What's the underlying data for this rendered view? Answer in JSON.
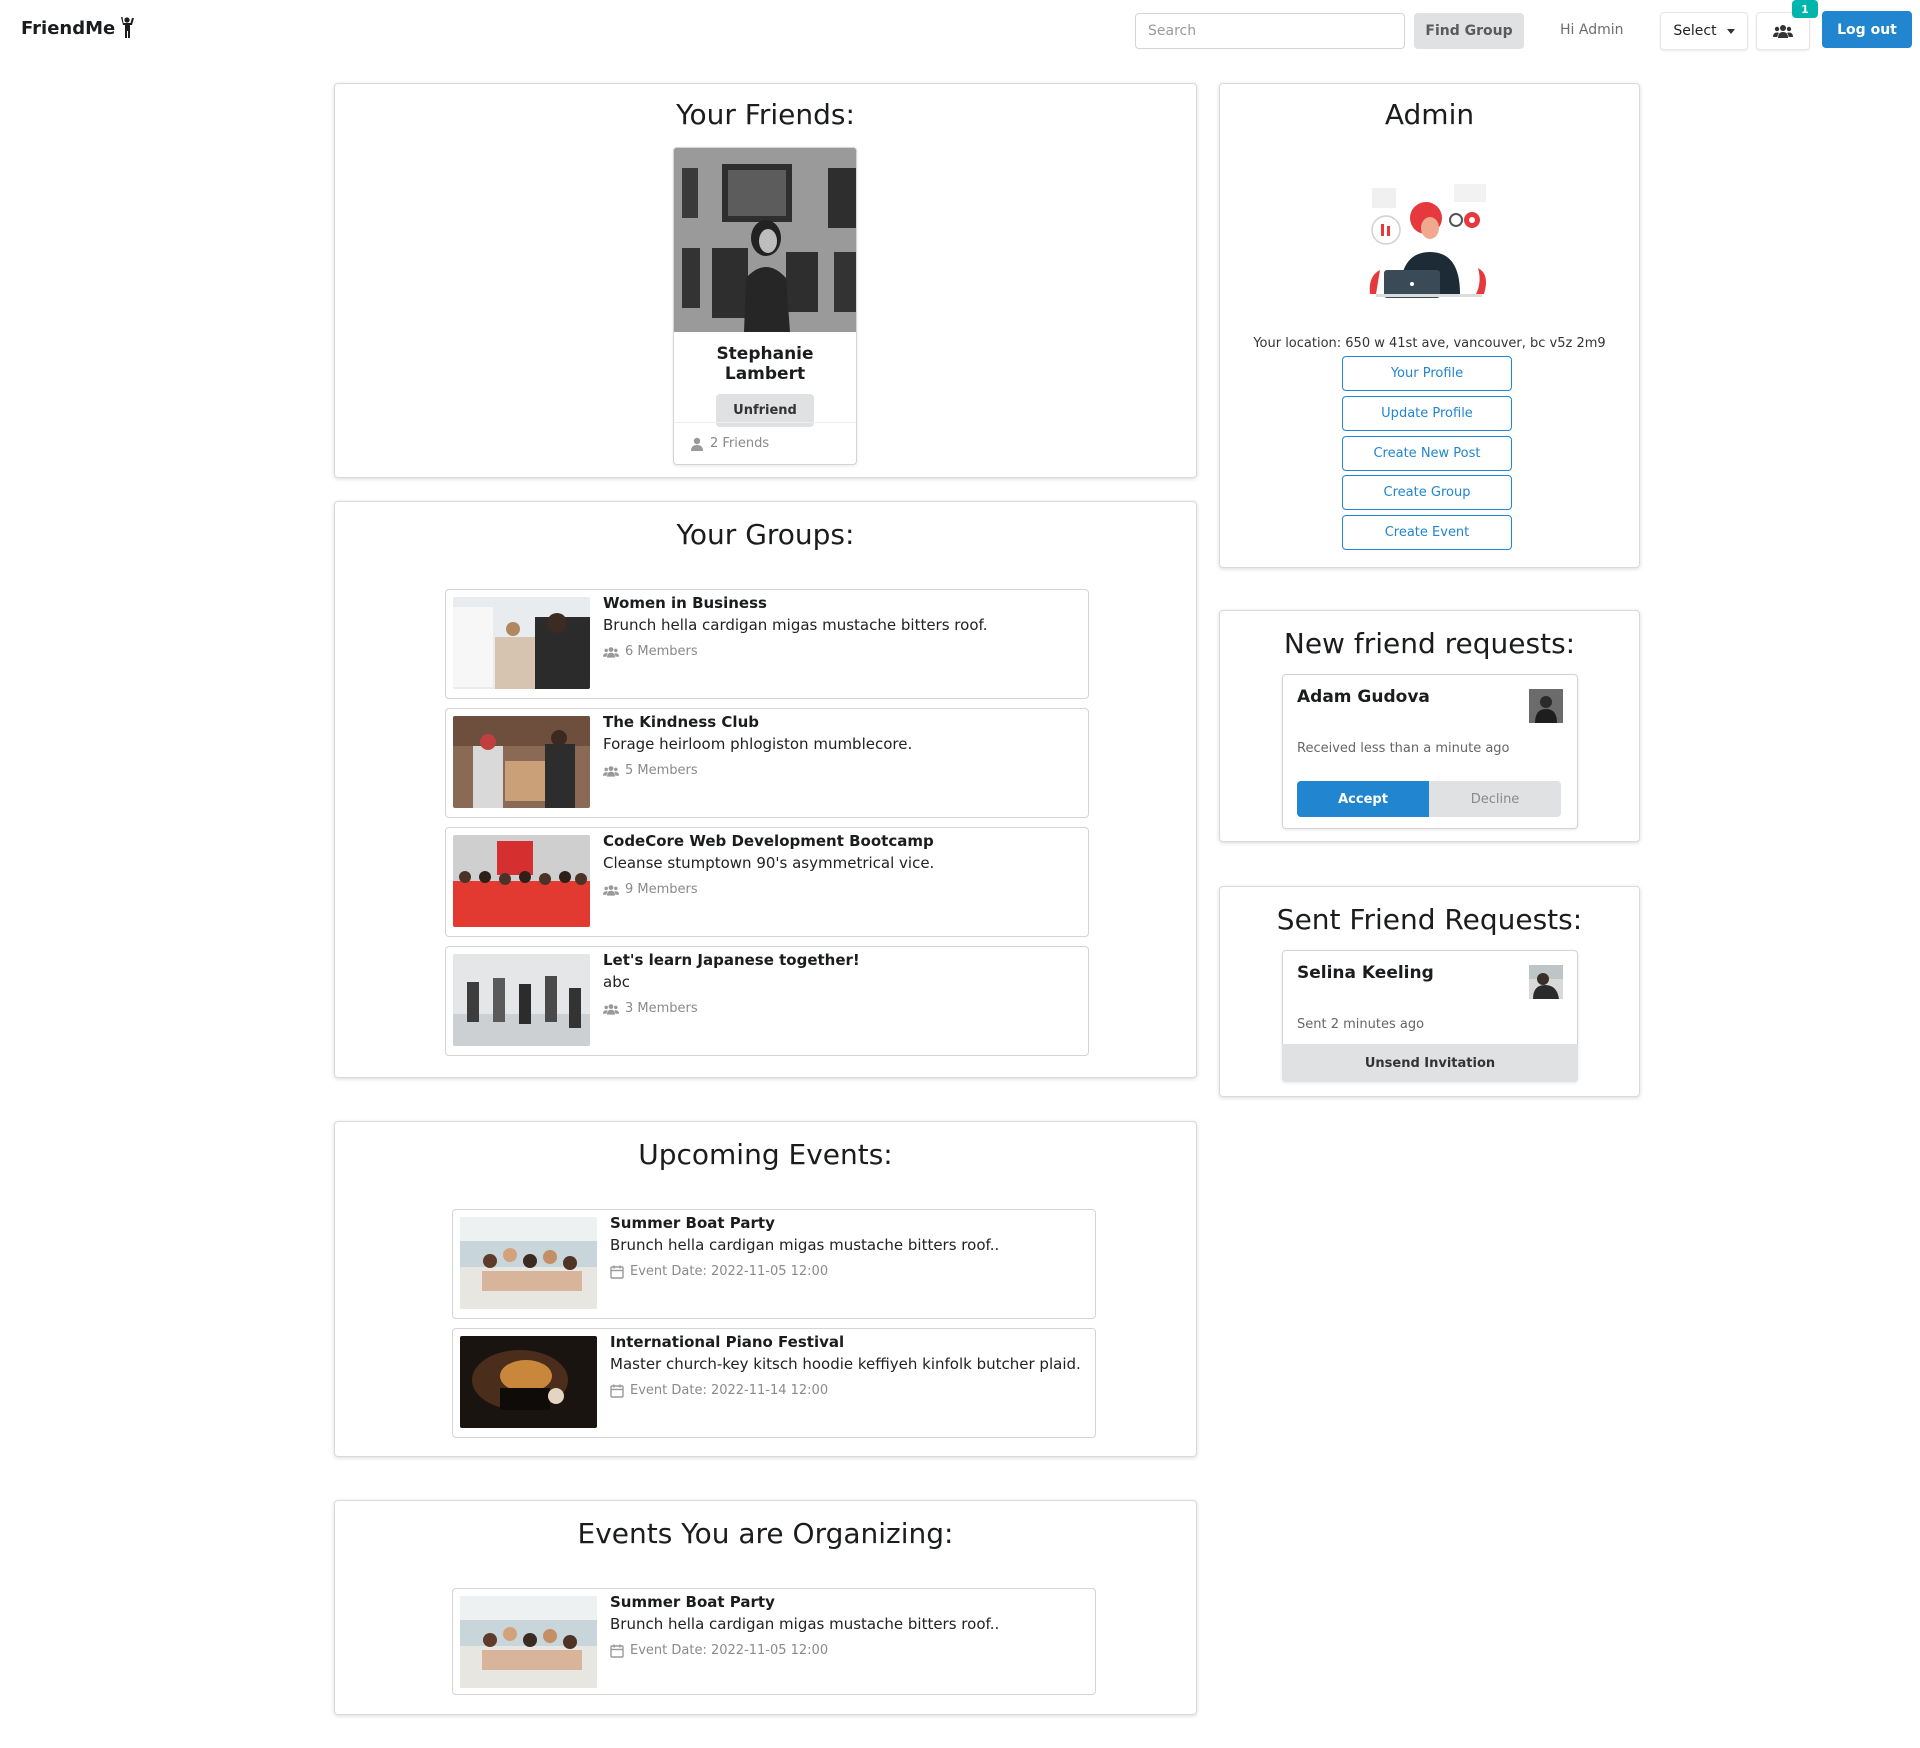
{
  "navbar": {
    "brand": "FriendMe",
    "search_placeholder": "Search",
    "find_group_label": "Find Group",
    "greeting": "Hi Admin",
    "select_label": "Select",
    "notification_count": "1",
    "logout_label": "Log out",
    "accent_color": "#2185d0",
    "badge_color": "#00b5ad"
  },
  "friends": {
    "title": "Your Friends:",
    "items": [
      {
        "name": "Stephanie Lambert",
        "action_label": "Unfriend",
        "friends_count": "2 Friends"
      }
    ]
  },
  "groups": {
    "title": "Your Groups:",
    "items": [
      {
        "name": "Women in Business",
        "description": "Brunch hella cardigan migas mustache bitters roof.",
        "members": "6 Members"
      },
      {
        "name": "The Kindness Club",
        "description": "Forage heirloom phlogiston mumblecore.",
        "members": "5 Members"
      },
      {
        "name": "CodeCore Web Development Bootcamp",
        "description": "Cleanse stumptown 90's asymmetrical vice.",
        "members": "9 Members"
      },
      {
        "name": "Let's learn Japanese together!",
        "description": "abc",
        "members": "3 Members"
      }
    ]
  },
  "upcoming_events": {
    "title": "Upcoming Events:",
    "items": [
      {
        "name": "Summer Boat Party",
        "description": "Brunch hella cardigan migas mustache bitters roof..",
        "date": "Event Date: 2022-11-05 12:00"
      },
      {
        "name": "International Piano Festival",
        "description": "Master church-key kitsch hoodie keffiyeh kinfolk butcher plaid.",
        "date": "Event Date: 2022-11-14 12:00"
      }
    ]
  },
  "organizing_events": {
    "title": "Events You are Organizing:",
    "items": [
      {
        "name": "Summer Boat Party",
        "description": "Brunch hella cardigan migas mustache bitters roof..",
        "date": "Event Date: 2022-11-05 12:00"
      }
    ]
  },
  "admin": {
    "title": "Admin",
    "location": "Your location: 650 w 41st ave, vancouver, bc v5z 2m9",
    "buttons": [
      "Your Profile",
      "Update Profile",
      "Create New Post",
      "Create Group",
      "Create Event"
    ]
  },
  "new_requests": {
    "title": "New friend requests:",
    "items": [
      {
        "name": "Adam Gudova",
        "meta": "Received less than a minute ago",
        "accept_label": "Accept",
        "decline_label": "Decline"
      }
    ]
  },
  "sent_requests": {
    "title": "Sent Friend Requests:",
    "items": [
      {
        "name": "Selina Keeling",
        "meta": "Sent 2 minutes ago",
        "action_label": "Unsend Invitation"
      }
    ]
  }
}
